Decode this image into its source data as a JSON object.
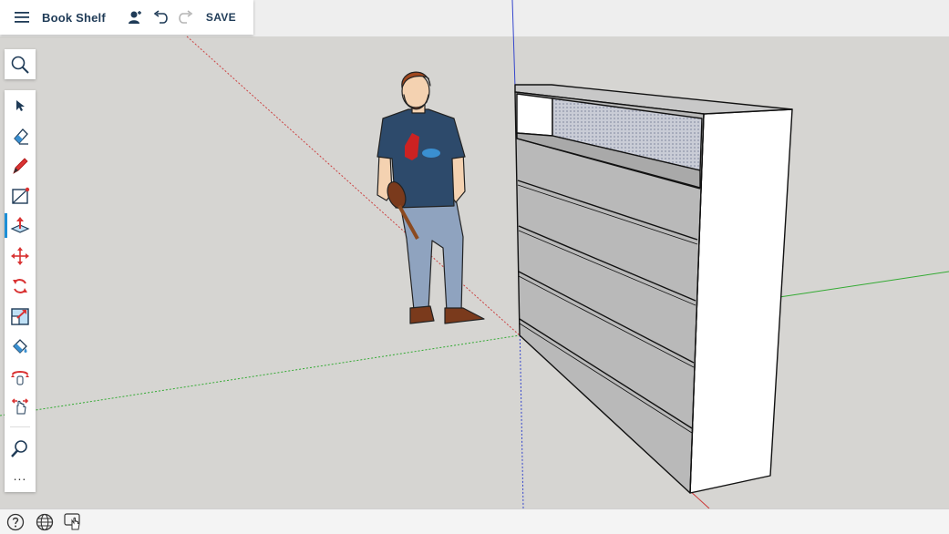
{
  "app": {
    "title": "Book Shelf",
    "save_label": "SAVE"
  },
  "topbar": {
    "icons": [
      "menu-icon",
      "user-icon",
      "undo-icon",
      "redo-icon"
    ]
  },
  "toolbar": {
    "search_icon": "search-icon",
    "tools": [
      {
        "name": "select",
        "icon": "cursor-icon",
        "active": false
      },
      {
        "name": "eraser",
        "icon": "eraser-icon",
        "active": false
      },
      {
        "name": "pencil",
        "icon": "pencil-icon",
        "active": false
      },
      {
        "name": "rectangle",
        "icon": "rectangle-icon",
        "active": false
      },
      {
        "name": "push-pull",
        "icon": "push-pull-icon",
        "active": true
      },
      {
        "name": "move",
        "icon": "move-icon",
        "active": false
      },
      {
        "name": "rotate",
        "icon": "rotate-icon",
        "active": false
      },
      {
        "name": "scale",
        "icon": "scale-icon",
        "active": false
      },
      {
        "name": "paint-bucket",
        "icon": "paint-bucket-icon",
        "active": false
      },
      {
        "name": "orbit",
        "icon": "orbit-icon",
        "active": false
      },
      {
        "name": "pan",
        "icon": "pan-icon",
        "active": false
      },
      {
        "name": "zoom",
        "icon": "zoom-icon",
        "active": false
      }
    ],
    "more_label": "..."
  },
  "statusbar": {
    "icons": [
      "help-icon",
      "globe-icon",
      "touch-icon"
    ]
  },
  "colors": {
    "accent": "#1d8fd6",
    "title": "#1f3b57",
    "axis_red": "#cc3333",
    "axis_green": "#33aa33",
    "axis_blue": "#3344cc",
    "sky": "#eeeeee",
    "ground": "#d6d5d2"
  }
}
